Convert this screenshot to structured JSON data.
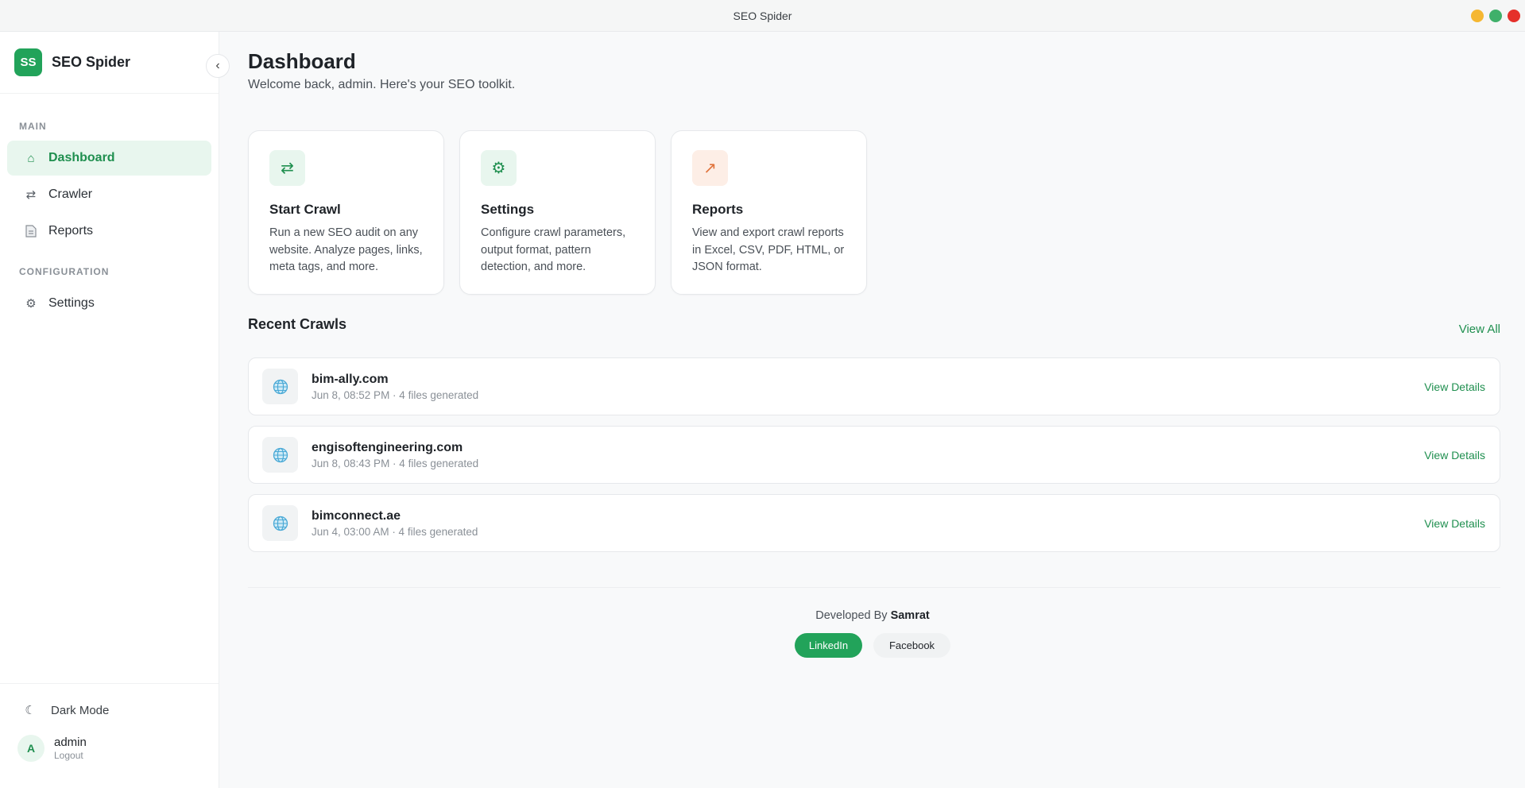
{
  "window": {
    "title": "SEO Spider",
    "controls": [
      {
        "name": "minimize",
        "color": "#f5b731"
      },
      {
        "name": "maximize",
        "color": "#3fb06a"
      },
      {
        "name": "close",
        "color": "#e5302a"
      }
    ]
  },
  "sidebar": {
    "logo_text": "SS",
    "app_name": "SEO Spider",
    "sections": [
      {
        "label": "MAIN"
      },
      {
        "label": "CONFIGURATION"
      }
    ],
    "items": [
      {
        "label": "Dashboard",
        "icon": "home-icon",
        "glyph": "⌂",
        "active": true
      },
      {
        "label": "Crawler",
        "icon": "swap-icon",
        "glyph": "⇄",
        "active": false
      },
      {
        "label": "Reports",
        "icon": "document-icon",
        "glyph": "📄",
        "active": false
      },
      {
        "label": "Settings",
        "icon": "gear-icon",
        "glyph": "⚙",
        "active": false
      }
    ],
    "dark_mode_label": "Dark Mode",
    "user": {
      "initial": "A",
      "name": "admin",
      "logout_label": "Logout"
    }
  },
  "main": {
    "title": "Dashboard",
    "subtitle": "Welcome back, admin. Here's your SEO toolkit.",
    "cards": [
      {
        "title": "Start Crawl",
        "description": "Run a new SEO audit on any website. Analyze pages, links, meta tags, and more.",
        "icon": "swap-icon",
        "glyph": "⇄",
        "icon_bg": "#e8f6ee",
        "icon_color": "#1f8f4f"
      },
      {
        "title": "Settings",
        "description": "Configure crawl parameters, output format, pattern detection, and more.",
        "icon": "gear-icon",
        "glyph": "⚙",
        "icon_bg": "#e8f6ee",
        "icon_color": "#1f8f4f"
      },
      {
        "title": "Reports",
        "description": "View and export crawl reports in Excel, CSV, PDF, HTML, or JSON format.",
        "icon": "trend-arrow-icon",
        "glyph": "↗",
        "icon_bg": "#fdeee6",
        "icon_color": "#e0733c"
      }
    ],
    "recent_title": "Recent Crawls",
    "view_all_label": "View All",
    "crawls": [
      {
        "domain": "bim-ally.com",
        "meta": "Jun 8, 08:52 PM · 4 files generated",
        "action": "View Details"
      },
      {
        "domain": "engisoftengineering.com",
        "meta": "Jun 8, 08:43 PM · 4 files generated",
        "action": "View Details"
      },
      {
        "domain": "bimconnect.ae",
        "meta": "Jun 4, 03:00 AM · 4 files generated",
        "action": "View Details"
      }
    ]
  },
  "footer": {
    "developed_by": "Developed By",
    "developer": "Samrat",
    "links": [
      "LinkedIn",
      "Facebook"
    ]
  },
  "colors": {
    "accent": "#22a35a",
    "accent_text": "#1f8f4f"
  }
}
